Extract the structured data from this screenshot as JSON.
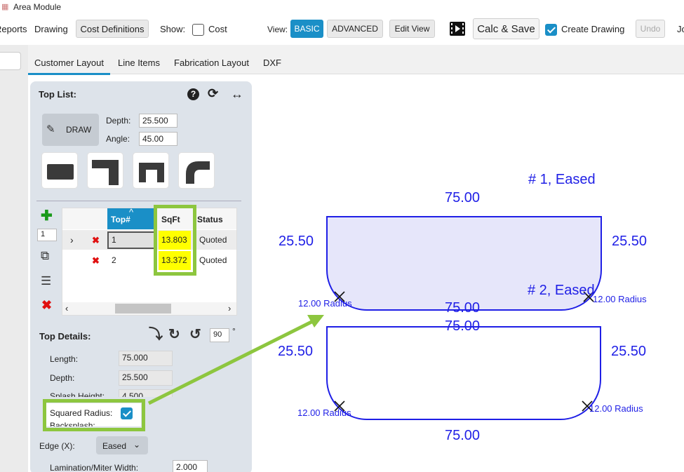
{
  "window": {
    "title": "Area Module"
  },
  "menu": {
    "reports": "Reports",
    "drawing": "Drawing",
    "cost_definitions": "Cost Definitions",
    "show": "Show:",
    "cost": "Cost"
  },
  "toolbar": {
    "view": "View:",
    "basic": "BASIC",
    "advanced": "ADVANCED",
    "edit_view": "Edit View",
    "calc_save": "Calc & Save",
    "create_drawing": "Create Drawing",
    "create_drawing_checked": true,
    "undo": "Undo",
    "jobs": "Jo"
  },
  "tabs": [
    "Customer Layout",
    "Line Items",
    "Fabrication Layout",
    "DXF"
  ],
  "active_tab": "Customer Layout",
  "top_list": {
    "title": "Top List:",
    "draw": "DRAW",
    "depth_label": "Depth:",
    "depth_value": "25.500",
    "angle_label": "Angle:",
    "angle_value": "45.00",
    "quantity": "1",
    "columns": [
      "Top#",
      "SqFt",
      "Status"
    ],
    "rows": [
      {
        "top": "1",
        "sqft": "13.803",
        "status": "Quoted"
      },
      {
        "top": "2",
        "sqft": "13.372",
        "status": "Quoted"
      }
    ]
  },
  "top_details": {
    "title": "Top Details:",
    "rotate_value": "90",
    "degree": "°",
    "length_label": "Length:",
    "length_value": "75.000",
    "depth_label": "Depth:",
    "depth_value": "25.500",
    "splash_label": "Splash Height:",
    "splash_value": "4.500",
    "squared_radius_label": "Squared Radius:",
    "squared_radius_checked": true,
    "backsplash_label": "Backsplash:",
    "edge_label": "Edge (X):",
    "edge_value": "Eased",
    "lamination_label": "Lamination/Miter Width:",
    "lamination_value": "2.000"
  },
  "drawing": {
    "top1": {
      "label": "# 1, Eased",
      "top_length": "75.00",
      "bottom_length": "75.00",
      "left_depth": "25.50",
      "right_depth": "25.50",
      "left_radius": "12.00 Radius",
      "right_radius": "12.00 Radius"
    },
    "top2": {
      "label": "# 2, Eased",
      "top_length": "75.00",
      "bottom_length": "75.00",
      "left_depth": "25.50",
      "right_depth": "25.50",
      "left_radius": "12.00 Radius",
      "right_radius": "12.00 Radius"
    }
  },
  "colors": {
    "accent": "#1a8fc7",
    "highlight": "#8dc63f",
    "sqft_fill": "#ffff00",
    "drawing_blue": "#1f1fe6",
    "top1_fill": "#e6e6fa",
    "delete_red": "#e01010",
    "add_green": "#1a9a1a"
  }
}
